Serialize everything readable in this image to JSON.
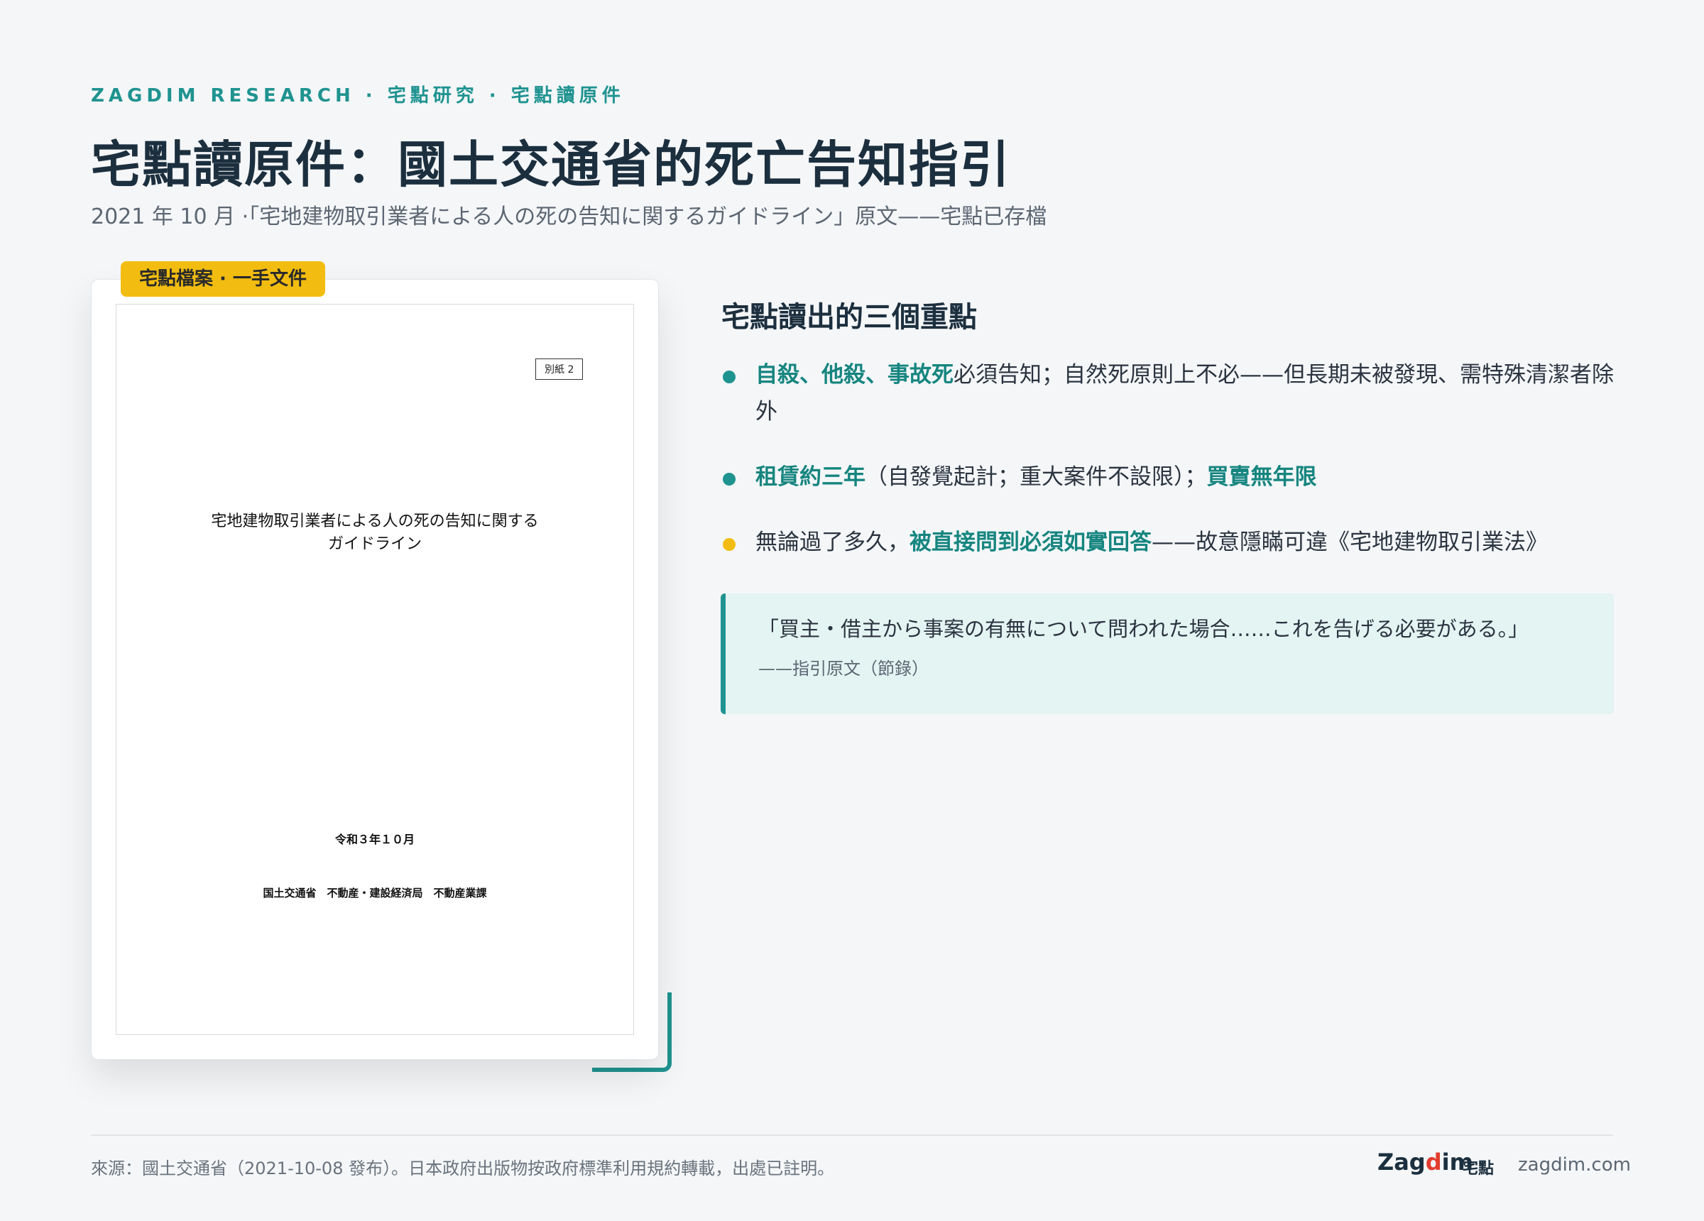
{
  "header": {
    "eyebrow": "ZAGDIM RESEARCH · 宅點研究 · 宅點讀原件",
    "title": "宅點讀原件：國土交通省的死亡告知指引",
    "subtitle": "2021 年 10 月 ·「宅地建物取引業者による人の死の告知に関するガイドライン」原文——宅點已存檔"
  },
  "document": {
    "badge": "宅點檔案 · 一手文件",
    "tag": "別紙 2",
    "title_line1": "宅地建物取引業者による人の死の告知に関する",
    "title_line2": "ガイドライン",
    "date": "令和３年１０月",
    "org": "国土交通省　不動産・建設経済局　不動産業課"
  },
  "summary": {
    "heading": "宅點讀出的三個重點",
    "points": [
      {
        "color": "#1f9390",
        "hl1": "自殺、他殺、事故死",
        "text1": "必須告知；自然死原則上不必——但長期未被發現、需特殊清潔者除外"
      },
      {
        "color": "#1f9390",
        "hl1": "租賃約三年",
        "text1": "（自發覺起計；重大案件不設限）；",
        "hl2": "買賣無年限"
      },
      {
        "color": "#f2bd10",
        "text0": "無論過了多久，",
        "hl1": "被直接問到必須如實回答",
        "text1": "——故意隱瞞可違《宅地建物取引業法》"
      }
    ],
    "quote": {
      "text": "「買主・借主から事案の有無について問われた場合……これを告げる必要がある。」",
      "source": "——指引原文（節錄）"
    }
  },
  "footer": {
    "source": "來源：國土交通省（2021-10-08 發布）。日本政府出版物按政府標準利用規約轉載，出處已註明。",
    "brand_pre": "Zag",
    "brand_accent": "d",
    "brand_post": "im",
    "brand_zh": "宅點",
    "site": "zagdim.com"
  },
  "colors": {
    "accent": "#1f9390",
    "highlight": "#f2bd10",
    "brand_red": "#e23c2e"
  }
}
